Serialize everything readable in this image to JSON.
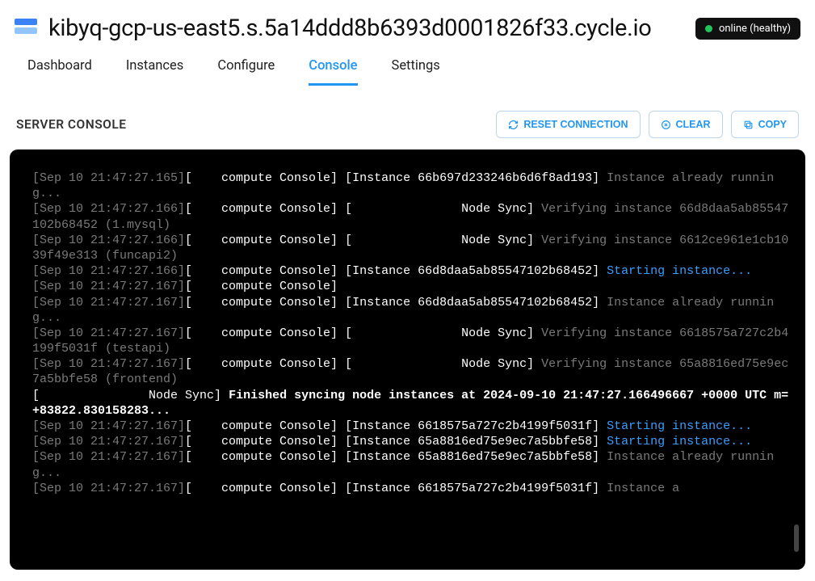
{
  "header": {
    "hostname": "kibyq-gcp-us-east5.s.5a14ddd8b6393d0001826f33.cycle.io",
    "status_text": "online (healthy)"
  },
  "tabs": [
    {
      "label": "Dashboard",
      "active": false
    },
    {
      "label": "Instances",
      "active": false
    },
    {
      "label": "Configure",
      "active": false
    },
    {
      "label": "Console",
      "active": true
    },
    {
      "label": "Settings",
      "active": false
    }
  ],
  "section": {
    "title": "SERVER CONSOLE",
    "buttons": {
      "reset": "RESET CONNECTION",
      "clear": "CLEAR",
      "copy": "COPY"
    }
  },
  "logs": [
    {
      "ts": "[Sep 10 21:47:27.165]",
      "scope": "[    compute Console]",
      "ctx": "[Instance 66b697d233246b6d6f8ad193]",
      "msg": "Instance already running...",
      "style": "dim"
    },
    {
      "ts": "[Sep 10 21:47:27.166]",
      "scope": "[    compute Console]",
      "ctx": "[               Node Sync]",
      "msg": "Verifying instance 66d8daa5ab85547102b68452 (1.mysql)",
      "style": "dim"
    },
    {
      "ts": "[Sep 10 21:47:27.166]",
      "scope": "[    compute Console]",
      "ctx": "[               Node Sync]",
      "msg": "Verifying instance 6612ce961e1cb1039f49e313 (funcapi2)",
      "style": "dim"
    },
    {
      "ts": "[Sep 10 21:47:27.166]",
      "scope": "[    compute Console]",
      "ctx": "[Instance 66d8daa5ab85547102b68452]",
      "msg": "Starting instance...",
      "style": "blue"
    },
    {
      "ts": "[Sep 10 21:47:27.167]",
      "scope": "[    compute Console]",
      "ctx": "",
      "msg": "",
      "style": "dim"
    },
    {
      "ts": "[Sep 10 21:47:27.167]",
      "scope": "[    compute Console]",
      "ctx": "[Instance 66d8daa5ab85547102b68452]",
      "msg": "Instance already running...",
      "style": "dim"
    },
    {
      "ts": "[Sep 10 21:47:27.167]",
      "scope": "[    compute Console]",
      "ctx": "[               Node Sync]",
      "msg": "Verifying instance 6618575a727c2b4199f5031f (testapi)",
      "style": "dim"
    },
    {
      "ts": "[Sep 10 21:47:27.167]",
      "scope": "[    compute Console]",
      "ctx": "[               Node Sync]",
      "msg": "Verifying instance 65a8816ed75e9ec7a5bbfe58 (frontend)",
      "style": "dim"
    },
    {
      "ts": "",
      "scope": "",
      "ctx": "[               Node Sync]",
      "msg": "Finished syncing node instances at 2024-09-10 21:47:27.166496667 +0000 UTC m=+83822.830158283...",
      "style": "bright"
    },
    {
      "ts": "[Sep 10 21:47:27.167]",
      "scope": "[    compute Console]",
      "ctx": "[Instance 6618575a727c2b4199f5031f]",
      "msg": "Starting instance...",
      "style": "blue"
    },
    {
      "ts": "[Sep 10 21:47:27.167]",
      "scope": "[    compute Console]",
      "ctx": "[Instance 65a8816ed75e9ec7a5bbfe58]",
      "msg": "Starting instance...",
      "style": "blue"
    },
    {
      "ts": "[Sep 10 21:47:27.167]",
      "scope": "[    compute Console]",
      "ctx": "[Instance 65a8816ed75e9ec7a5bbfe58]",
      "msg": "Instance already running...",
      "style": "dim"
    },
    {
      "ts": "[Sep 10 21:47:27.167]",
      "scope": "[    compute Console]",
      "ctx": "[Instance 6618575a727c2b4199f5031f]",
      "msg": "Instance a",
      "style": "dim"
    }
  ]
}
